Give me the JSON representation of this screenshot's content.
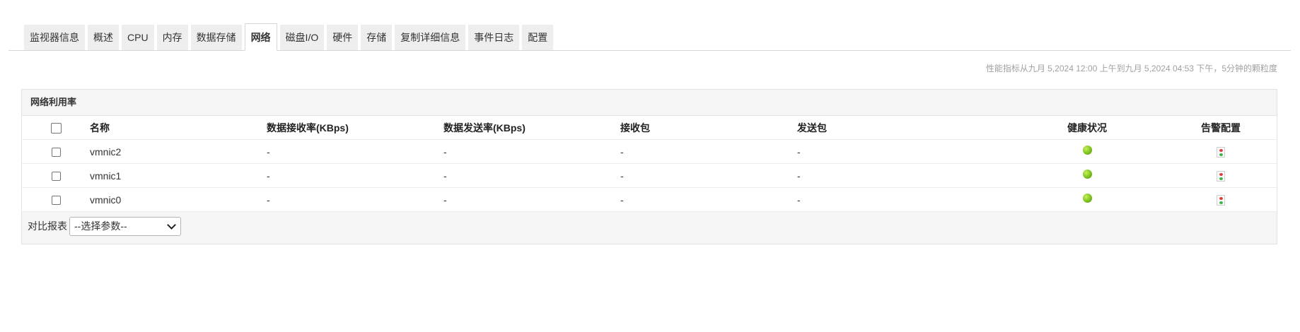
{
  "tabs": [
    {
      "label": "监视器信息",
      "active": false
    },
    {
      "label": "概述",
      "active": false
    },
    {
      "label": "CPU",
      "active": false
    },
    {
      "label": "内存",
      "active": false
    },
    {
      "label": "数据存储",
      "active": false
    },
    {
      "label": "网络",
      "active": true
    },
    {
      "label": "磁盘I/O",
      "active": false
    },
    {
      "label": "硬件",
      "active": false
    },
    {
      "label": "存储",
      "active": false
    },
    {
      "label": "复制详细信息",
      "active": false
    },
    {
      "label": "事件日志",
      "active": false
    },
    {
      "label": "配置",
      "active": false
    }
  ],
  "perf_note": "性能指标从九月 5,2024 12:00 上午到九月 5,2024 04:53 下午，5分钟的颗粒度",
  "panel": {
    "title": "网络利用率",
    "columns": {
      "name": "名称",
      "rx_rate": "数据接收率(KBps)",
      "tx_rate": "数据发送率(KBps)",
      "rx_packets": "接收包",
      "tx_packets": "发送包",
      "health": "健康状况",
      "alarm": "告警配置"
    },
    "rows": [
      {
        "name": "vmnic2",
        "rx_rate": "-",
        "tx_rate": "-",
        "rx_packets": "-",
        "tx_packets": "-",
        "health": "green-dot-icon",
        "alarm": "alarm-config-icon"
      },
      {
        "name": "vmnic1",
        "rx_rate": "-",
        "tx_rate": "-",
        "rx_packets": "-",
        "tx_packets": "-",
        "health": "green-dot-icon",
        "alarm": "alarm-config-icon"
      },
      {
        "name": "vmnic0",
        "rx_rate": "-",
        "tx_rate": "-",
        "rx_packets": "-",
        "tx_packets": "-",
        "health": "green-dot-icon",
        "alarm": "alarm-config-icon"
      }
    ],
    "compare_label": "对比报表",
    "compare_select": "--选择参数--"
  },
  "colors": {
    "health_ok": "#7cc11e",
    "tab_bg": "#eeeeee",
    "panel_bg": "#f5f5f5"
  }
}
